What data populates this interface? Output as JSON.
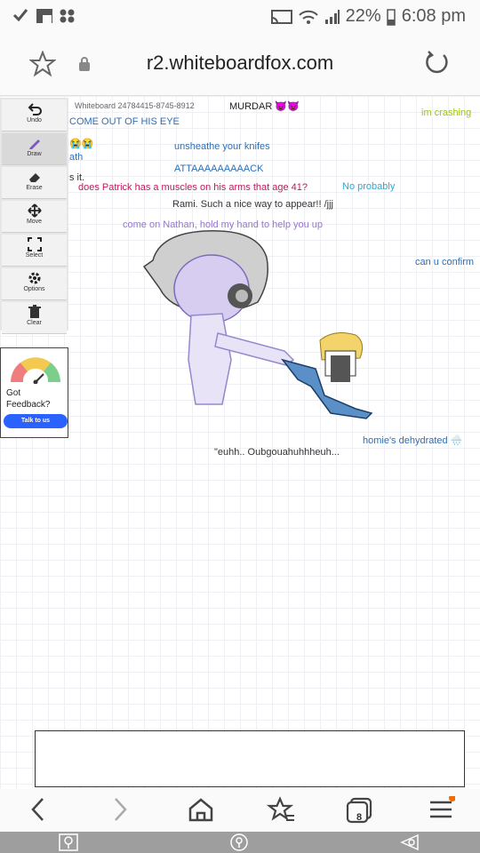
{
  "status": {
    "battery": "22%",
    "time": "6:08 pm"
  },
  "browser": {
    "url": "r2.whiteboardfox.com",
    "tab_count": "8"
  },
  "toolbar": {
    "tools": [
      {
        "label": "Undo",
        "icon": "undo-icon"
      },
      {
        "label": "Draw",
        "icon": "pencil-icon"
      },
      {
        "label": "Erase",
        "icon": "eraser-icon"
      },
      {
        "label": "Move",
        "icon": "move-icon"
      },
      {
        "label": "Select",
        "icon": "select-icon"
      },
      {
        "label": "Options",
        "icon": "gear-icon"
      },
      {
        "label": "Clear",
        "icon": "trash-icon"
      }
    ]
  },
  "feedback": {
    "text": "Got Feedback?",
    "button": "Talk to us"
  },
  "board": {
    "id": "Whiteboard 24784415-8745-8912",
    "texts": [
      {
        "text": "MURDAR 😈😈",
        "color": "#222222"
      },
      {
        "text": "COME OUT OF HIS EYE",
        "color": "#2d6fb6"
      },
      {
        "text": "im crashing",
        "color": "#9bc21a"
      },
      {
        "text": "😭😭",
        "color": "#222222"
      },
      {
        "text": "ath",
        "color": "#2d6fb6"
      },
      {
        "text": "unsheathe your knifes",
        "color": "#2d6fb6"
      },
      {
        "text": "ATTAAAAAAAAACK",
        "color": "#2d6fb6"
      },
      {
        "text": "s it.",
        "color": "#333333"
      },
      {
        "text": "does Patrick has a muscles on his arms that age 41?",
        "color": "#c2185b"
      },
      {
        "text": "No probably",
        "color": "#29a9d6"
      },
      {
        "text": "Rami. Such a nice way to appear!! /jjj",
        "color": "#333333"
      },
      {
        "text": "come on Nathan, hold my hand to help you up",
        "color": "#9575cd"
      },
      {
        "text": "can u confirm",
        "color": "#2d6fb6"
      },
      {
        "text": "\"euhh.. Oubgouahuhhheuh...",
        "color": "#333333"
      },
      {
        "text": "homie's dehydrated 🌧️",
        "color": "#2d6fb6"
      }
    ]
  }
}
